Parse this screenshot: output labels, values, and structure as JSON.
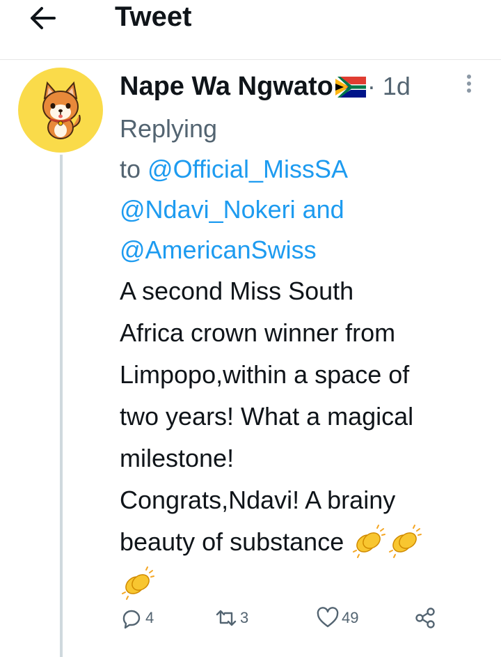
{
  "header": {
    "title": "Tweet"
  },
  "tweet": {
    "author_name": "Nape Wa Ngwato",
    "separator": "·",
    "time_ago": "1d",
    "replying": {
      "line1": "Replying",
      "to_prefix": "to ",
      "mention_1": "@Official_MissSA",
      "mention_2": "@Ndavi_Nokeri",
      "and_word": " and",
      "mention_3": "@AmericanSwiss"
    },
    "text_lines": [
      "A second Miss South",
      "Africa crown winner from",
      "Limpopo,within a space of",
      "two years! What a magical",
      "milestone!",
      "Congrats,Ndavi! A brainy",
      "beauty of substance "
    ],
    "emoji": [
      "clapping-hands-icon",
      "clapping-hands-icon",
      "clapping-hands-icon"
    ],
    "actions": {
      "replies": "4",
      "retweets": "3",
      "likes": "49"
    }
  },
  "colors": {
    "text": "#0f1419",
    "secondary": "#536471",
    "link": "#1d9bf0",
    "avatar_bg": "#fadb4a",
    "thread_line": "#cfd9de"
  }
}
